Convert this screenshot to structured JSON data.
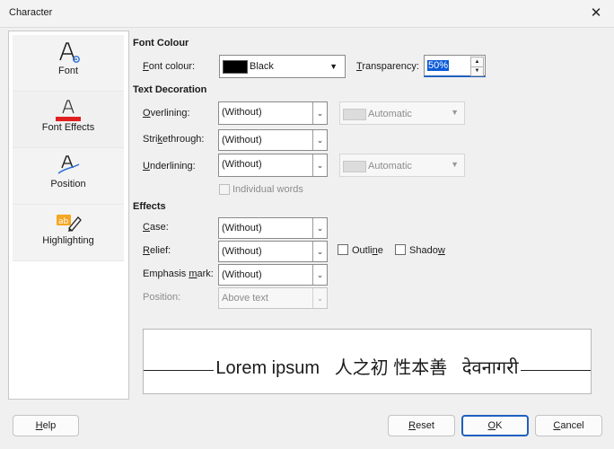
{
  "window": {
    "title": "Character",
    "close_glyph": "✕"
  },
  "sidebar": {
    "items": [
      {
        "label": "Font",
        "icon": "font-icon"
      },
      {
        "label": "Font Effects",
        "icon": "font-effects-icon",
        "selected": true
      },
      {
        "label": "Position",
        "icon": "position-icon"
      },
      {
        "label": "Highlighting",
        "icon": "highlighting-icon"
      }
    ]
  },
  "font_colour": {
    "heading": "Font Colour",
    "label": "Font colour:",
    "value": "Black",
    "swatch": "#000000",
    "transparency_label": "Transparency:",
    "transparency_value": "50%"
  },
  "text_decoration": {
    "heading": "Text Decoration",
    "overlining_label": "Overlining:",
    "overlining_value": "(Without)",
    "overlining_colour": "Automatic",
    "strikethrough_label": "Strikethrough:",
    "strikethrough_value": "(Without)",
    "underlining_label": "Underlining:",
    "underlining_value": "(Without)",
    "underlining_colour": "Automatic",
    "individual_words": "Individual words"
  },
  "effects": {
    "heading": "Effects",
    "case_label": "Case:",
    "case_value": "(Without)",
    "relief_label": "Relief:",
    "relief_value": "(Without)",
    "outline_label": "Outline",
    "shadow_label": "Shadow",
    "emphasis_label": "Emphasis mark:",
    "emphasis_value": "(Without)",
    "position_label": "Position:",
    "position_value": "Above text"
  },
  "preview": {
    "text": "Lorem ipsum   人之初 性本善   देवनागरी"
  },
  "buttons": {
    "help": "Help",
    "reset": "Reset",
    "ok": "OK",
    "cancel": "Cancel"
  },
  "colors": {
    "accent": "#1f5fbf",
    "selection": "#0b5ad8",
    "red_bar": "#e02020"
  }
}
